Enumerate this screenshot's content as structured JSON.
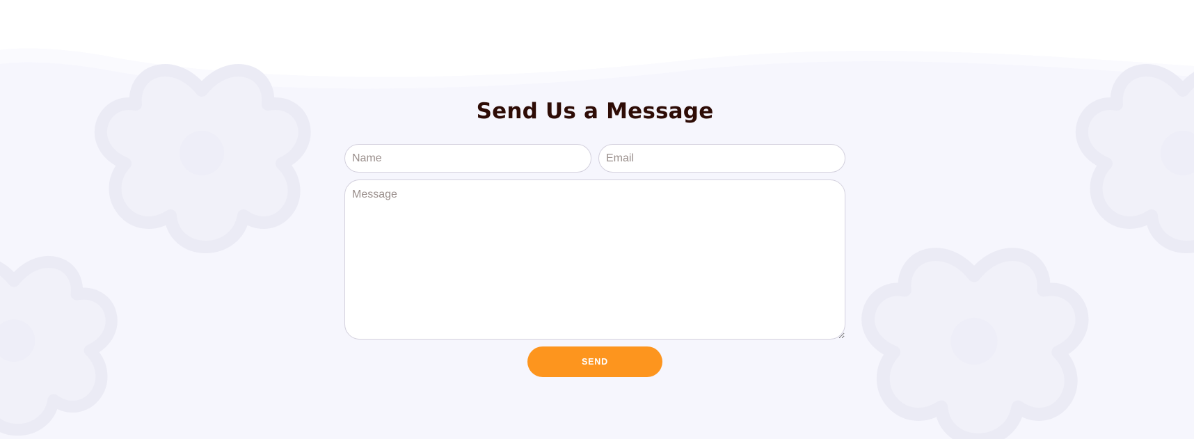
{
  "form": {
    "title": "Send Us a Message",
    "name_placeholder": "Name",
    "email_placeholder": "Email",
    "message_placeholder": "Message",
    "send_label": "SEND"
  },
  "colors": {
    "background": "#f6f6fd",
    "title": "#2e0c06",
    "button": "#fd951e",
    "field_border": "#d3d0dd"
  }
}
